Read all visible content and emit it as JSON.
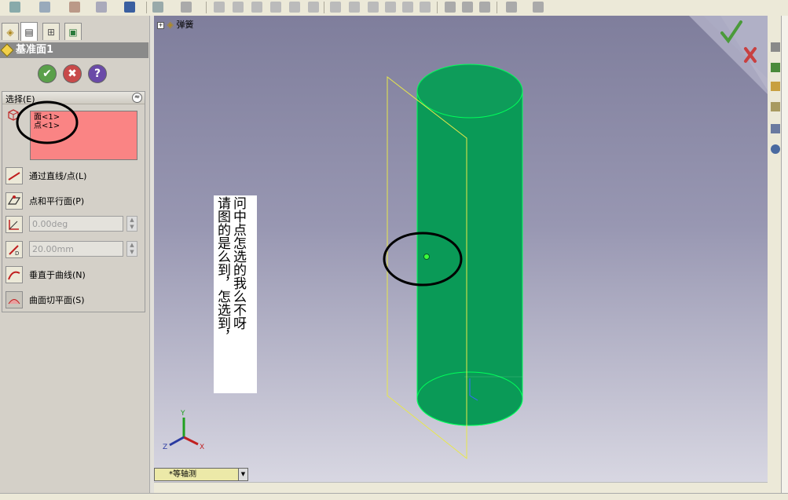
{
  "panel": {
    "title": "基准面1",
    "section_label": "选择(E)",
    "collapse_symbol": "≈",
    "selections": [
      "面<1>",
      "点<1>"
    ],
    "options": {
      "through_lines": "通过直线/点(L)",
      "parallel_plane": "点和平行面(P)",
      "angle_value": "0.00deg",
      "offset_value": "20.00mm",
      "normal_to_curve": "垂直于曲线(N)",
      "surface_tangent": "曲面切平面(S)"
    }
  },
  "tree": {
    "root_label": "弹簧"
  },
  "note": {
    "col1": "请图的是么到，怎选到，",
    "col2": "问中点怎选的我么不呀"
  },
  "view": {
    "orientation": "*等轴测"
  },
  "triad": {
    "x": "X",
    "y": "Y",
    "z": "Z"
  },
  "colors": {
    "cylinder": "#0a9a57",
    "plane": "#e8e84a",
    "selection_box": "#fa8484"
  }
}
